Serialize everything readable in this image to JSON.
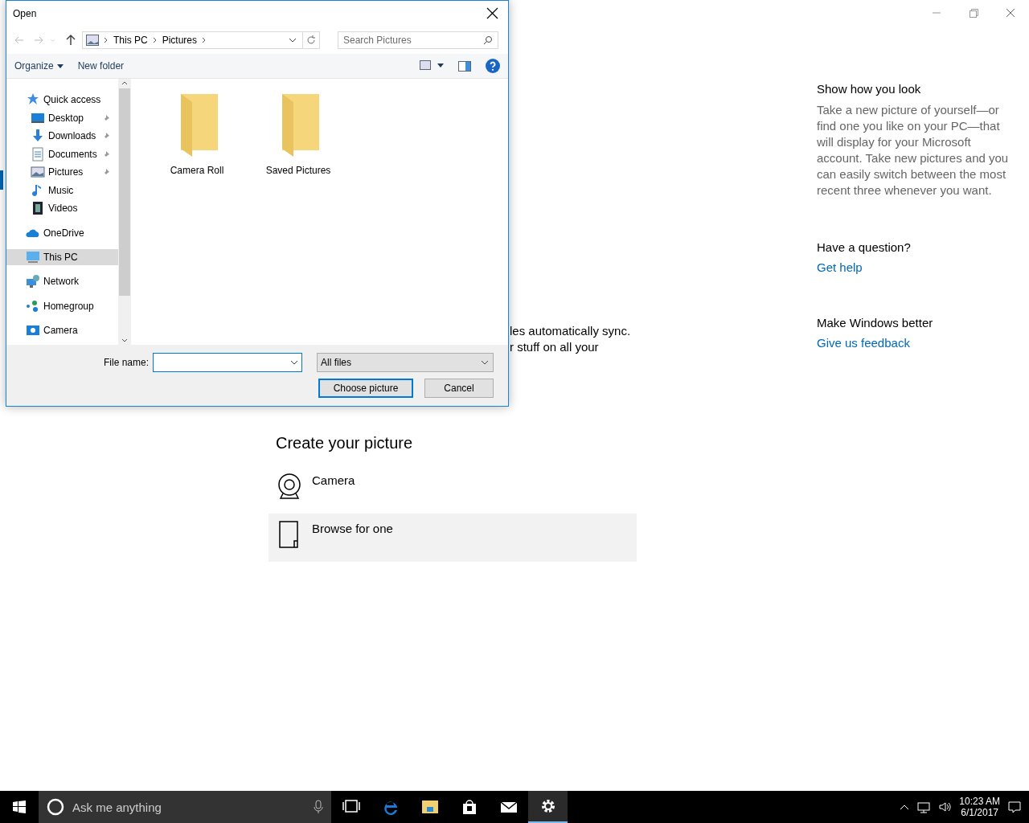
{
  "settings": {
    "fragments": [
      "les automatically sync.",
      "r stuff on all your"
    ],
    "create_heading": "Create your picture",
    "options": [
      {
        "label": "Camera",
        "kind": "camera",
        "selected": false
      },
      {
        "label": "Browse for one",
        "kind": "browse",
        "selected": true
      }
    ],
    "side": [
      {
        "heading": "Show how you look",
        "body": "Take a new picture of yourself—or find one you like on your PC—that will display for your Microsoft account. Take new pictures and you can easily switch between the most recent three whenever you want."
      },
      {
        "heading": "Have a question?",
        "link": "Get help"
      },
      {
        "heading": "Make Windows better",
        "link": "Give us feedback"
      }
    ]
  },
  "dialog": {
    "title": "Open",
    "breadcrumb": [
      "This PC",
      "Pictures"
    ],
    "search": {
      "placeholder": "Search Pictures"
    },
    "toolbar": [
      "Organize",
      "New folder"
    ],
    "nav": [
      {
        "label": "Quick access",
        "kind": "star",
        "selected": false,
        "children": [
          {
            "label": "Desktop",
            "kind": "desktop",
            "selected": false,
            "pinned": true
          },
          {
            "label": "Downloads",
            "kind": "download",
            "selected": false,
            "pinned": true
          },
          {
            "label": "Documents",
            "kind": "document",
            "selected": false,
            "pinned": true
          },
          {
            "label": "Pictures",
            "kind": "picture",
            "selected": false,
            "pinned": true
          },
          {
            "label": "Music",
            "kind": "music",
            "selected": false,
            "pinned": false
          },
          {
            "label": "Videos",
            "kind": "video",
            "selected": false,
            "pinned": false
          }
        ]
      },
      {
        "label": "OneDrive",
        "kind": "cloud",
        "selected": false
      },
      {
        "label": "This PC",
        "kind": "pc",
        "selected": true
      },
      {
        "label": "Network",
        "kind": "network",
        "selected": false
      },
      {
        "label": "Homegroup",
        "kind": "homegroup",
        "selected": false
      },
      {
        "label": "Camera",
        "kind": "camera",
        "selected": false
      }
    ],
    "files": [
      "Camera Roll",
      "Saved Pictures"
    ],
    "file_name_label": "File name:",
    "file_type": "All files",
    "buttons": [
      {
        "label": "Choose picture",
        "default": true
      },
      {
        "label": "Cancel",
        "default": false
      }
    ]
  },
  "taskbar": {
    "search_placeholder": "Ask me anything",
    "apps": [
      {
        "kind": "taskview",
        "active": false
      },
      {
        "kind": "browser",
        "active": false
      },
      {
        "kind": "folder",
        "active": false
      },
      {
        "kind": "store",
        "active": false
      },
      {
        "kind": "mail",
        "active": false
      },
      {
        "kind": "gear",
        "active": true
      }
    ],
    "time": "10:23 AM",
    "date": "6/1/2017"
  }
}
